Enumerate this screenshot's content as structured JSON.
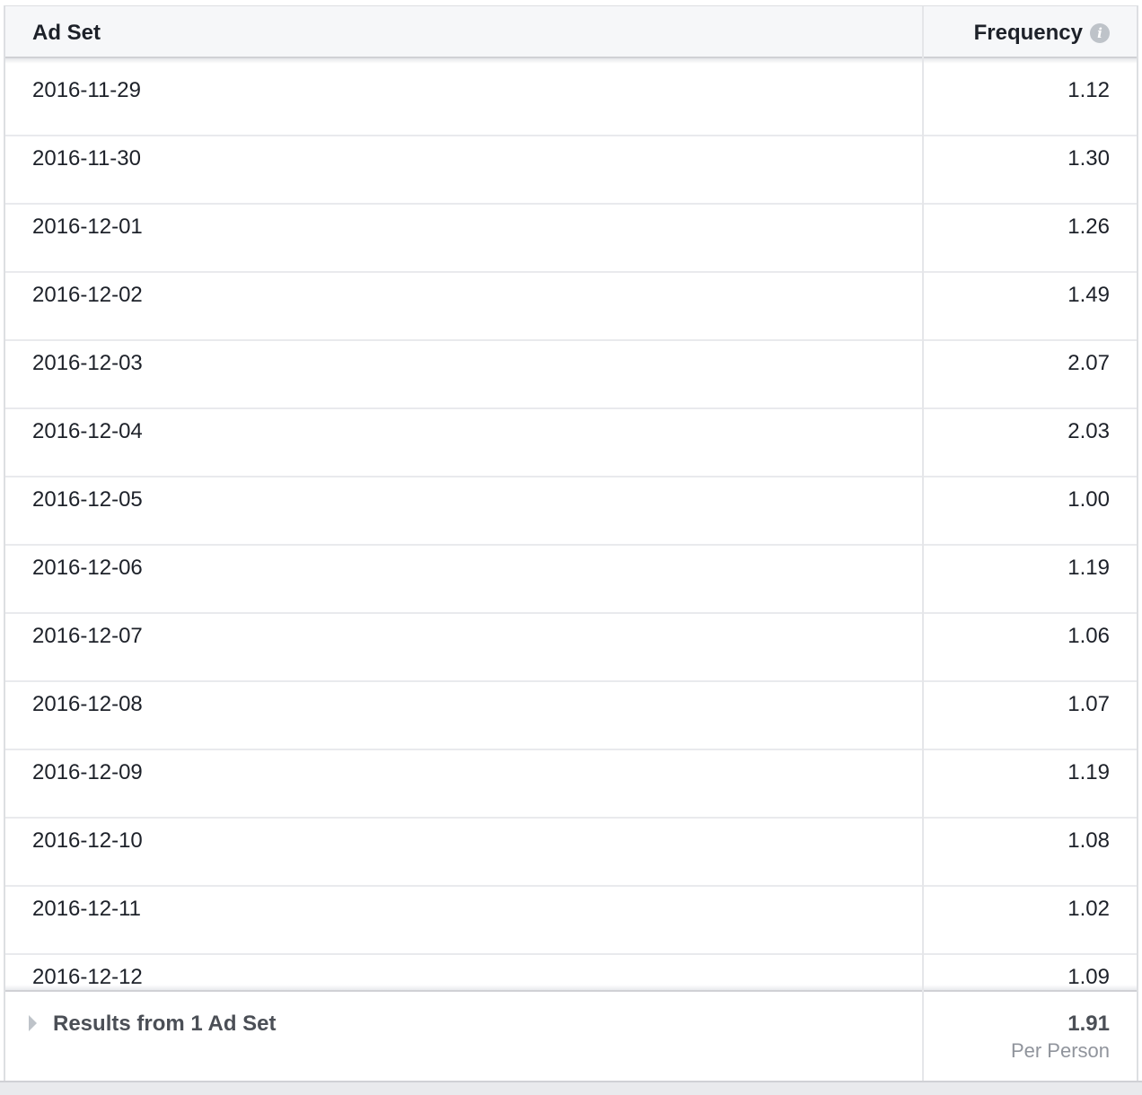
{
  "table": {
    "columns": {
      "ad_set": "Ad Set",
      "frequency": "Frequency"
    },
    "info_icon": "info-icon",
    "rows": [
      {
        "date": "2016-11-29",
        "frequency": "1.12"
      },
      {
        "date": "2016-11-30",
        "frequency": "1.30"
      },
      {
        "date": "2016-12-01",
        "frequency": "1.26"
      },
      {
        "date": "2016-12-02",
        "frequency": "1.49"
      },
      {
        "date": "2016-12-03",
        "frequency": "2.07"
      },
      {
        "date": "2016-12-04",
        "frequency": "2.03"
      },
      {
        "date": "2016-12-05",
        "frequency": "1.00"
      },
      {
        "date": "2016-12-06",
        "frequency": "1.19"
      },
      {
        "date": "2016-12-07",
        "frequency": "1.06"
      },
      {
        "date": "2016-12-08",
        "frequency": "1.07"
      },
      {
        "date": "2016-12-09",
        "frequency": "1.19"
      },
      {
        "date": "2016-12-10",
        "frequency": "1.08"
      },
      {
        "date": "2016-12-11",
        "frequency": "1.02"
      },
      {
        "date": "2016-12-12",
        "frequency": "1.09"
      }
    ],
    "footer": {
      "results_label": "Results from 1 Ad Set",
      "total_frequency": "1.91",
      "total_sub": "Per Person"
    }
  }
}
